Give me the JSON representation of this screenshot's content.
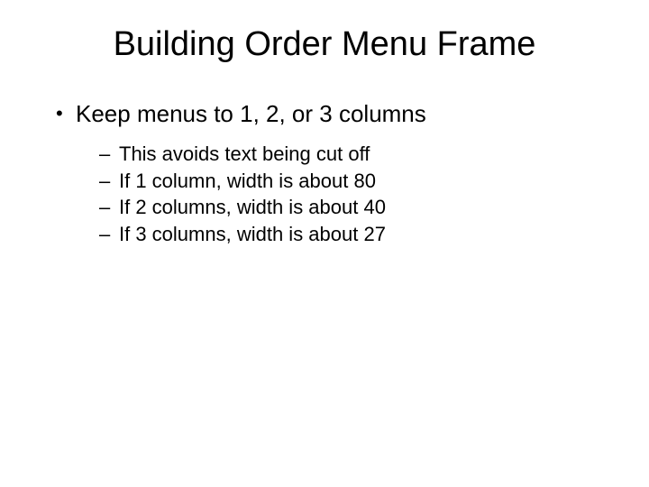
{
  "slide": {
    "title": "Building Order Menu Frame",
    "bullets": [
      {
        "text": "Keep menus to 1, 2, or 3 columns",
        "sub": [
          "This avoids text being cut off",
          "If 1 column, width is about 80",
          "If 2 columns, width is about 40",
          "If 3 columns, width is about 27"
        ]
      }
    ]
  }
}
